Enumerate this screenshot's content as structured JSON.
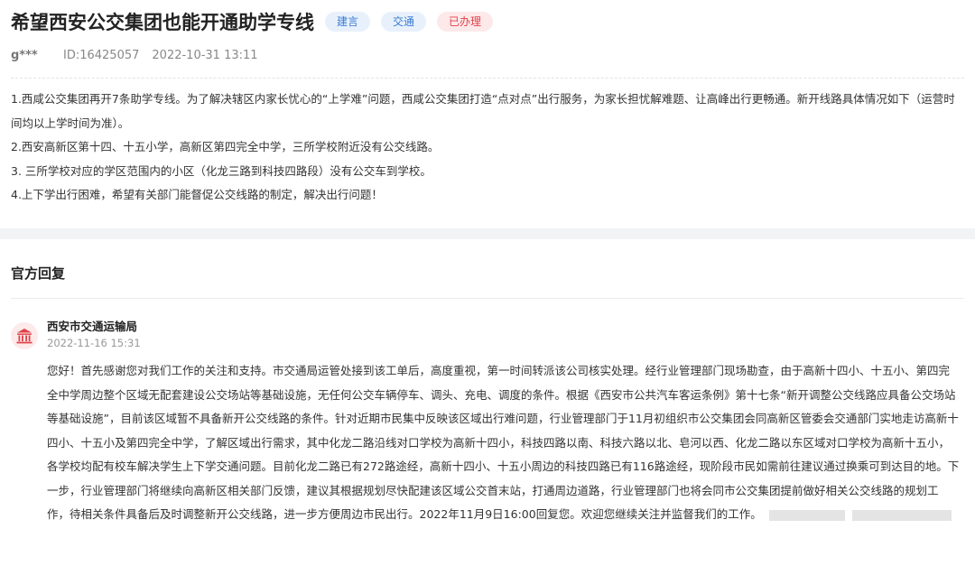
{
  "post": {
    "title": "希望西安公交集团也能开通助学专线",
    "tags": [
      {
        "label": "建言",
        "color": "#3a7bd5"
      },
      {
        "label": "交通",
        "color": "#3a7bd5"
      },
      {
        "label": "已办理",
        "color": "#e0424a"
      }
    ],
    "user": "g***",
    "id": "ID:16425057",
    "datetime": "2022-10-31 13:11",
    "paragraphs": [
      "1.西咸公交集团再开7条助学专线。为了解决辖区内家长忧心的“上学难”问题，西咸公交集团打造“点对点”出行服务，为家长担忧解难题、让高峰出行更畅通。新开线路具体情况如下（运营时间均以上学时间为准）。",
      "2.西安高新区第十四、十五小学，高新区第四完全中学，三所学校附近没有公交线路。",
      "3. 三所学校对应的学区范围内的小区（化龙三路到科技四路段）没有公交车到学校。",
      "4.上下学出行困难，希望有关部门能督促公交线路的制定，解决出行问题！"
    ]
  },
  "reply": {
    "heading": "官方回复",
    "org_name": "西安市交通运输局",
    "datetime": "2022-11-16 15:31",
    "text": "您好！首先感谢您对我们工作的关注和支持。市交通局运管处接到该工单后，高度重视，第一时间转派该公司核实处理。经行业管理部门现场勘查，由于高新十四小、十五小、第四完全中学周边整个区域无配套建设公交场站等基础设施，无任何公交车辆停车、调头、充电、调度的条件。根据《西安市公共汽车客运条例》第十七条“新开调整公交线路应具备公交场站等基础设施”，目前该区域暂不具备新开公交线路的条件。针对近期市民集中反映该区域出行难问题，行业管理部门于11月初组织市公交集团会同高新区管委会交通部门实地走访高新十四小、十五小及第四完全中学，了解区域出行需求，其中化龙二路沿线对口学校为高新十四小，科技四路以南、科技六路以北、皂河以西、化龙二路以东区域对口学校为高新十五小，各学校均配有校车解决学生上下学交通问题。目前化龙二路已有272路途经，高新十四小、十五小周边的科技四路已有116路途经，现阶段市民如需前往建议通过换乘可到达目的地。下一步，行业管理部门将继续向高新区相关部门反馈，建议其根据规划尽快配建该区域公交首末站，打通周边道路，行业管理部门也将会同市公交集团提前做好相关公交线路的规划工作，待相关条件具备后及时调整新开公交线路，进一步方便周边市民出行。2022年11月9日16:00回复您。欢迎您继续关注并监督我们的工作。"
  },
  "icons": {
    "avatar": "government-building-icon"
  },
  "colors": {
    "accent_blue": "#3a7bd5",
    "status_red": "#e0424a",
    "avatar_bg": "#fdeaea",
    "avatar_fg": "#e0424a"
  }
}
